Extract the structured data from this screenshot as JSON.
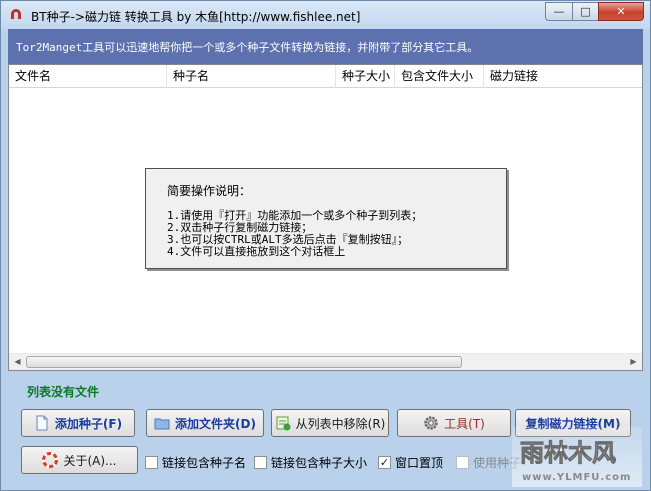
{
  "window": {
    "title": "BT种子->磁力链 转换工具 by 木鱼[http://www.fishlee.net]",
    "min_glyph": "—",
    "max_glyph": "□",
    "close_glyph": "✕"
  },
  "header": {
    "text": "Tor2Manget工具可以迅速地帮你把一个或多个种子文件转换为链接，并附带了部分其它工具。"
  },
  "list": {
    "columns": [
      "文件名",
      "种子名",
      "种子大小",
      "包含文件大小",
      "磁力链接"
    ]
  },
  "info": {
    "title": "简要操作说明：",
    "lines": [
      "1.请使用『打开』功能添加一个或多个种子到列表；",
      "2.双击种子行复制磁力链接；",
      "3.也可以按CTRL或ALT多选后点击『复制按钮』；",
      "4.文件可以直接拖放到这个对话框上"
    ]
  },
  "status": {
    "text": "列表没有文件"
  },
  "buttons": {
    "add_torrent": "添加种子(F)",
    "add_folder": "添加文件夹(D)",
    "remove": "从列表中移除(R)",
    "tools": "工具(T)",
    "copy_magnet": "复制磁力链接(M)",
    "about": "关于(A)..."
  },
  "options": {
    "include_names": {
      "label": "链接包含种子名",
      "checked": false
    },
    "include_size": {
      "label": "链接包含种子大小",
      "checked": false
    },
    "topmost": {
      "label": "窗口置顶",
      "checked": true
    },
    "use_torrent": {
      "label": "使用种子",
      "checked": false,
      "disabled": true
    }
  },
  "watermark": {
    "brand": "雨林木风",
    "url": "www.YLMFU.com"
  },
  "colors": {
    "header_bg": "#5c71ad",
    "status_green": "#0a7a28",
    "button_text_blue": "#1a3c9c"
  }
}
